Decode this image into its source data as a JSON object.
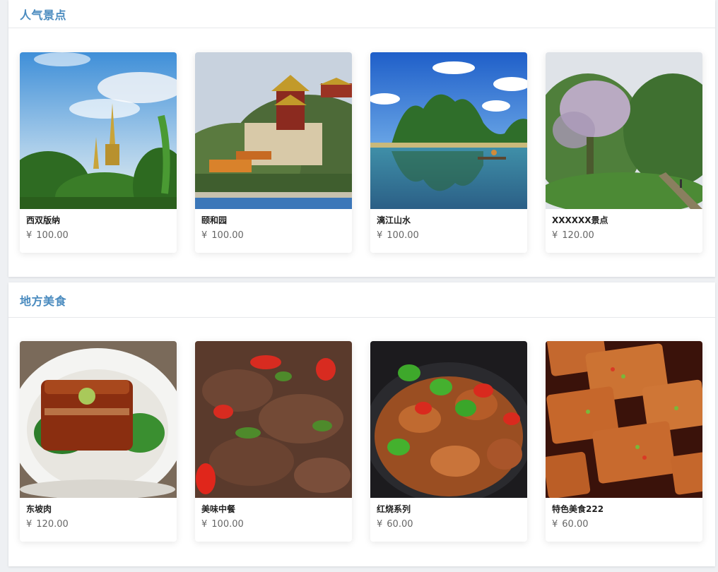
{
  "sections": [
    {
      "title": "人气景点",
      "items": [
        {
          "name": "西双版纳",
          "currency": "¥",
          "price": "100.00",
          "icon": "tropical-pagoda-photo"
        },
        {
          "name": "颐和园",
          "currency": "¥",
          "price": "100.00",
          "icon": "summer-palace-photo"
        },
        {
          "name": "漓江山水",
          "currency": "¥",
          "price": "100.00",
          "icon": "li-river-photo"
        },
        {
          "name": "XXXXXX景点",
          "currency": "¥",
          "price": "120.00",
          "icon": "forest-path-photo"
        }
      ]
    },
    {
      "title": "地方美食",
      "items": [
        {
          "name": "东坡肉",
          "currency": "¥",
          "price": "120.00",
          "icon": "braised-pork-photo"
        },
        {
          "name": "美味中餐",
          "currency": "¥",
          "price": "100.00",
          "icon": "stir-fry-photo"
        },
        {
          "name": "红烧系列",
          "currency": "¥",
          "price": "60.00",
          "icon": "braised-intestine-photo"
        },
        {
          "name": "特色美食222",
          "currency": "¥",
          "price": "60.00",
          "icon": "fried-tofu-photo"
        }
      ]
    }
  ],
  "colors": {
    "accent": "#4a8bbf",
    "background": "#eef0f3"
  }
}
